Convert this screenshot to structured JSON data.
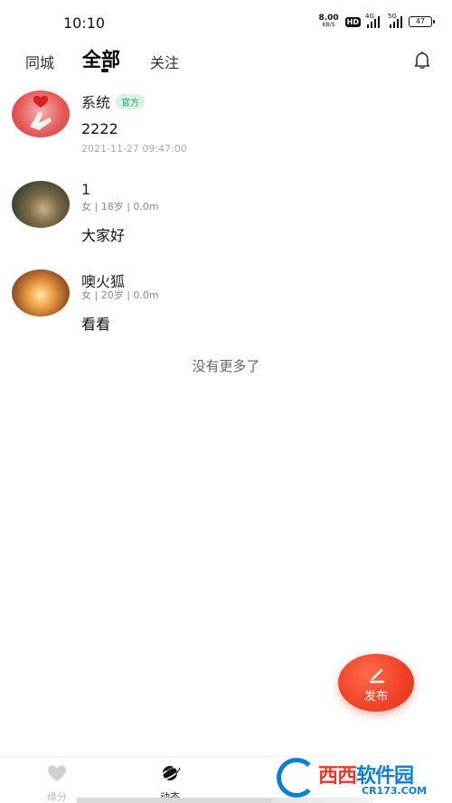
{
  "status_bar": {
    "time": "10:10",
    "net_speed": "8.00",
    "net_unit": "KB/S",
    "hd": "HD",
    "signal1": "4G",
    "signal2": "5G",
    "battery": "47"
  },
  "tabs": {
    "local": "同城",
    "all": "全部",
    "follow": "关注",
    "active": "all"
  },
  "posts": [
    {
      "name": "系统",
      "badge": "官方",
      "content": "2222",
      "time": "2021-11-27 09:47:00"
    },
    {
      "name": "1",
      "meta": "女 | 18岁 | 0.0m",
      "content": "大家好"
    },
    {
      "name": "噢火狐",
      "meta": "女 | 20岁 | 0.0m",
      "content": "看看"
    }
  ],
  "no_more": "没有更多了",
  "fab": {
    "label": "发布",
    "color": "#f04127"
  },
  "bottom_nav": {
    "items": [
      {
        "label": "缘分",
        "icon": "heart-icon",
        "active": false
      },
      {
        "label": "动态",
        "icon": "planet-icon",
        "active": true
      }
    ]
  },
  "watermark": {
    "text_red": "西西",
    "text_blue": "软件园",
    "url": "CR173.COM"
  }
}
